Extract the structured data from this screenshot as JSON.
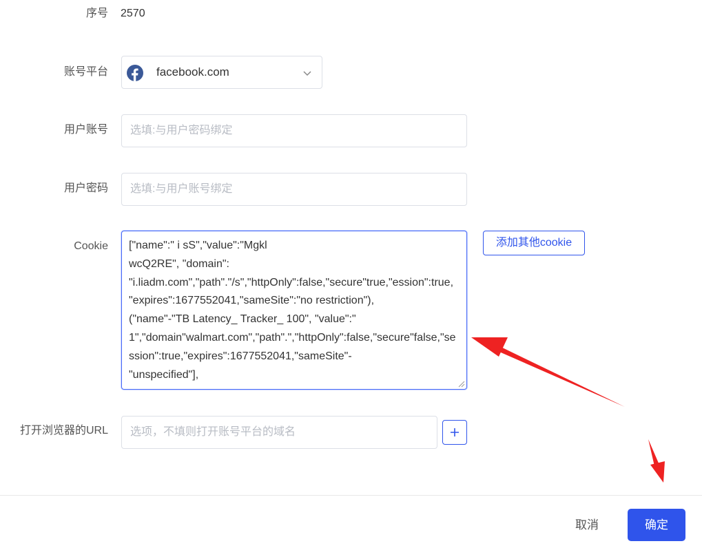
{
  "form": {
    "serial": {
      "label": "序号",
      "value": "2570"
    },
    "platform": {
      "label": "账号平台",
      "selected": "facebook.com",
      "icon": "facebook-icon"
    },
    "account": {
      "label": "用户账号",
      "placeholder": "选填:与用户密码绑定"
    },
    "password": {
      "label": "用户密码",
      "placeholder": "选填:与用户账号绑定"
    },
    "cookie": {
      "label": "Cookie",
      "value": "[\"name\":\" i sS\",\"value\":\"Mgkl\nwcQ2RE\", \"domain\":\n\"i.liadm.com\",\"path\".\"/s\",\"httpOnly\":false,\"secure\"true,\"ession\":true, \"expires\":1677552041,\"sameSite\":\"no restriction\"),\n(\"name\"-\"TB Latency_ Tracker_ 100\", \"value\":\"\n1\",\"domain\"walmart.com\",\"path\".\",\"httpOnly\":false,\"secure\"false,\"session\":true,\"expires\":1677552041,\"sameSite\"-\n\"unspecified\"],",
      "add_button": "添加其他cookie"
    },
    "url": {
      "label": "打开浏览器的URL",
      "placeholder": "选项，不填则打开账号平台的域名"
    }
  },
  "footer": {
    "cancel": "取消",
    "confirm": "确定"
  },
  "colors": {
    "primary": "#2f54eb",
    "annotation": "#ee2222"
  }
}
